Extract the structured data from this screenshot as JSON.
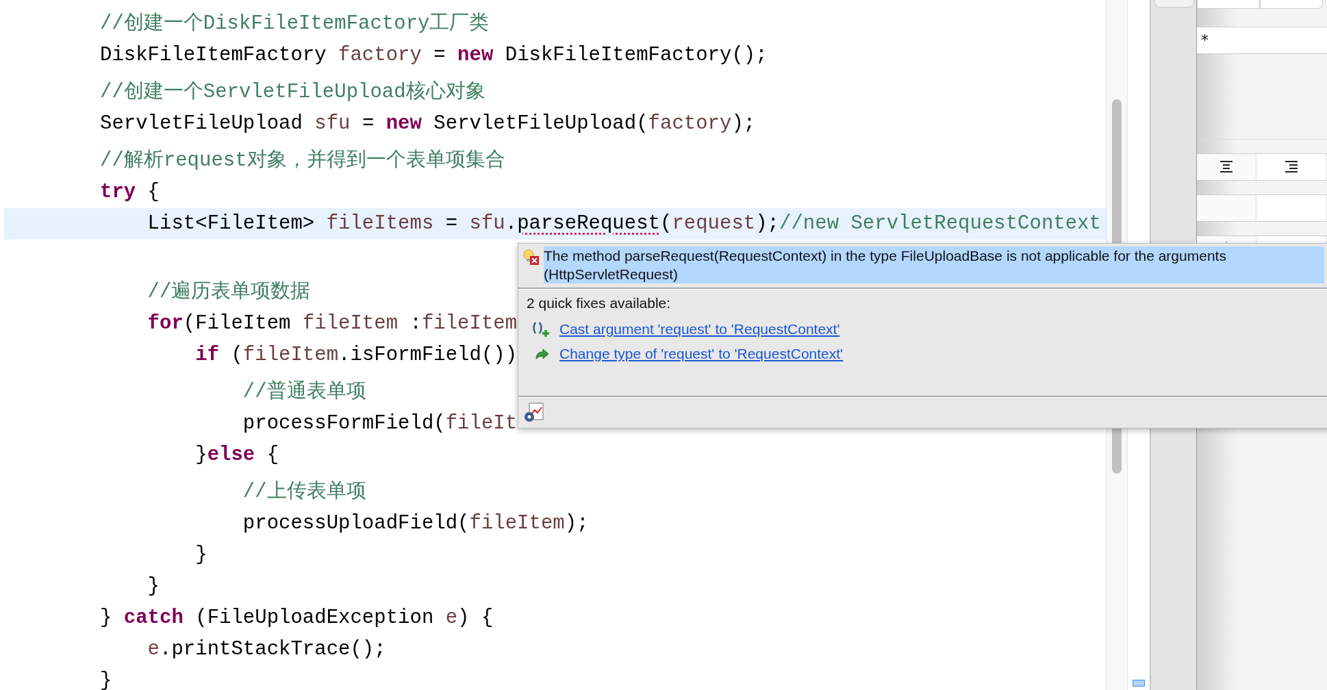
{
  "editor": {
    "lines": [
      {
        "kind": "comment",
        "current": false,
        "segments": [
          {
            "kind": "comment",
            "text": "//创建一个DiskFileItemFactory工厂类"
          }
        ]
      },
      {
        "kind": "code",
        "current": false,
        "segments": [
          {
            "kind": "plain",
            "text": "DiskFileItemFactory "
          },
          {
            "kind": "var",
            "text": "factory"
          },
          {
            "kind": "plain",
            "text": " = "
          },
          {
            "kind": "keyword",
            "text": "new"
          },
          {
            "kind": "plain",
            "text": " DiskFileItemFactory();"
          }
        ]
      },
      {
        "kind": "comment",
        "current": false,
        "segments": [
          {
            "kind": "comment",
            "text": "//创建一个ServletFileUpload核心对象"
          }
        ]
      },
      {
        "kind": "code",
        "current": false,
        "segments": [
          {
            "kind": "plain",
            "text": "ServletFileUpload "
          },
          {
            "kind": "var",
            "text": "sfu"
          },
          {
            "kind": "plain",
            "text": " = "
          },
          {
            "kind": "keyword",
            "text": "new"
          },
          {
            "kind": "plain",
            "text": " ServletFileUpload("
          },
          {
            "kind": "var",
            "text": "factory"
          },
          {
            "kind": "plain",
            "text": ");"
          }
        ]
      },
      {
        "kind": "comment",
        "current": false,
        "segments": [
          {
            "kind": "comment",
            "text": "//解析request对象，并得到一个表单项集合"
          }
        ]
      },
      {
        "kind": "code",
        "current": false,
        "segments": [
          {
            "kind": "keyword",
            "text": "try"
          },
          {
            "kind": "plain",
            "text": " {"
          }
        ]
      },
      {
        "kind": "code",
        "current": true,
        "segments": [
          {
            "kind": "plain",
            "text": "    List<FileItem> "
          },
          {
            "kind": "var",
            "text": "fileItems"
          },
          {
            "kind": "plain",
            "text": " = "
          },
          {
            "kind": "var",
            "text": "sfu"
          },
          {
            "kind": "plain",
            "text": "."
          },
          {
            "kind": "error",
            "text": "parseRequest"
          },
          {
            "kind": "plain",
            "text": "("
          },
          {
            "kind": "var",
            "text": "request"
          },
          {
            "kind": "plain",
            "text": ");"
          },
          {
            "kind": "comment",
            "text": "//new ServletRequestContext"
          }
        ]
      },
      {
        "kind": "blank",
        "current": false
      },
      {
        "kind": "comment",
        "current": false,
        "segments": [
          {
            "kind": "comment",
            "text": "    //遍历表单项数据"
          }
        ]
      },
      {
        "kind": "code",
        "current": false,
        "segments": [
          {
            "kind": "keyword",
            "text": "    for"
          },
          {
            "kind": "plain",
            "text": "(FileItem "
          },
          {
            "kind": "var",
            "text": "fileItem"
          },
          {
            "kind": "plain",
            "text": " :"
          },
          {
            "kind": "var",
            "text": "fileItem"
          }
        ]
      },
      {
        "kind": "code",
        "current": false,
        "segments": [
          {
            "kind": "keyword",
            "text": "        if"
          },
          {
            "kind": "plain",
            "text": " ("
          },
          {
            "kind": "var",
            "text": "fileItem"
          },
          {
            "kind": "plain",
            "text": ".isFormField())"
          }
        ]
      },
      {
        "kind": "comment",
        "current": false,
        "segments": [
          {
            "kind": "comment",
            "text": "            //普通表单项"
          }
        ]
      },
      {
        "kind": "code",
        "current": false,
        "segments": [
          {
            "kind": "plain",
            "text": "            processFormField("
          },
          {
            "kind": "var",
            "text": "fileIt"
          }
        ]
      },
      {
        "kind": "code",
        "current": false,
        "segments": [
          {
            "kind": "plain",
            "text": "        }"
          },
          {
            "kind": "keyword",
            "text": "else"
          },
          {
            "kind": "plain",
            "text": " {"
          }
        ]
      },
      {
        "kind": "comment",
        "current": false,
        "segments": [
          {
            "kind": "comment",
            "text": "            //上传表单项"
          }
        ]
      },
      {
        "kind": "code",
        "current": false,
        "segments": [
          {
            "kind": "plain",
            "text": "            processUploadField("
          },
          {
            "kind": "var",
            "text": "fileItem"
          },
          {
            "kind": "plain",
            "text": ");"
          }
        ]
      },
      {
        "kind": "code",
        "current": false,
        "segments": [
          {
            "kind": "plain",
            "text": "        }"
          }
        ]
      },
      {
        "kind": "code",
        "current": false,
        "segments": [
          {
            "kind": "plain",
            "text": "    }"
          }
        ]
      },
      {
        "kind": "code",
        "current": false,
        "segments": [
          {
            "kind": "plain",
            "text": "} "
          },
          {
            "kind": "keyword",
            "text": "catch"
          },
          {
            "kind": "plain",
            "text": " (FileUploadException "
          },
          {
            "kind": "var",
            "text": "e"
          },
          {
            "kind": "plain",
            "text": ") {"
          }
        ]
      },
      {
        "kind": "code",
        "current": false,
        "segments": [
          {
            "kind": "var",
            "text": "    e"
          },
          {
            "kind": "plain",
            "text": ".printStackTrace();"
          }
        ]
      },
      {
        "kind": "code",
        "current": false,
        "segments": [
          {
            "kind": "plain",
            "text": "}"
          }
        ]
      }
    ]
  },
  "popup": {
    "message": "The method parseRequest(RequestContext) in the type FileUploadBase is not applicable for the arguments (HttpServletRequest)",
    "message_selected": true,
    "heading": "2 quick fixes available:",
    "fixes": [
      {
        "kind": "cast",
        "label": "Cast argument 'request' to 'RequestContext'"
      },
      {
        "kind": "change",
        "label": "Change type of 'request' to 'RequestContext'"
      }
    ]
  },
  "side_panel": {
    "field_value": "*"
  }
}
